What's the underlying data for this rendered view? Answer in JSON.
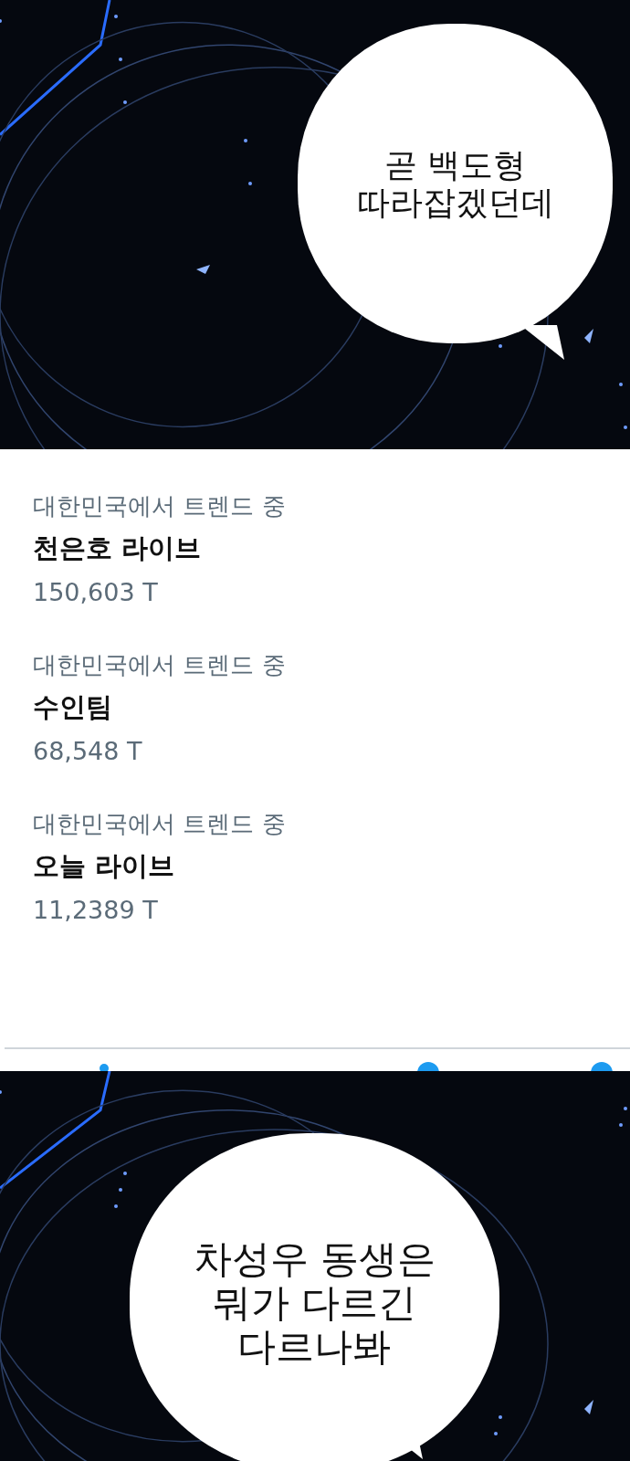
{
  "top_panel": {
    "kind": "picture",
    "bubble": "곧 백도형\n따라잡겠던데"
  },
  "trends": [
    {
      "category": "대한민국에서 트렌드 중",
      "title": "천은호 라이브",
      "count": "150,603 T"
    },
    {
      "category": "대한민국에서 트렌드 중",
      "title": "수인팀",
      "count": "68,548 T"
    },
    {
      "category": "대한민국에서 트렌드 중",
      "title": "오늘 라이브",
      "count": "11,2389 T"
    }
  ],
  "bottom_panel": {
    "kind": "picture",
    "bubble": "차성우 동생은\n뭐가 다르긴\n다르나봐"
  }
}
